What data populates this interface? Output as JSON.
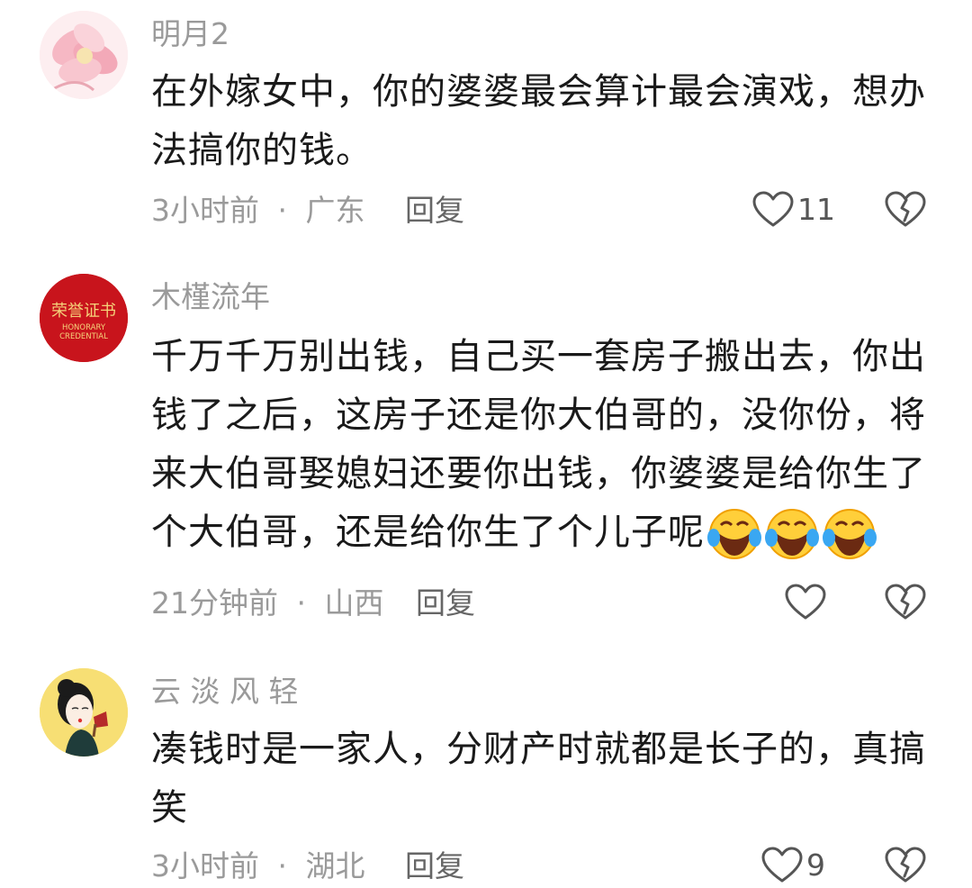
{
  "comments": [
    {
      "username": "明月2",
      "avatar": "pink-flower-avatar",
      "text": "在外嫁女中，你的婆婆最会算计最会演戏，想办法搞你的钱。",
      "time": "3小时前",
      "separator": "·",
      "location": "广东",
      "reply_label": "回复",
      "like_count": "11"
    },
    {
      "username": "木槿流年",
      "avatar": "honorary-credential-avatar",
      "avatar_text_cn": "荣誉证书",
      "avatar_text_en1": "HONORARY",
      "avatar_text_en2": "CREDENTIAL",
      "text": "千万千万别出钱，自己买一套房子搬出去，你出钱了之后，这房子还是你大伯哥的，没你份，将来大伯哥娶媳妇还要你出钱，你婆婆是给你生了个大伯哥，还是给你生了个儿子呢",
      "emojis": [
        "laugh-cry-emoji",
        "laugh-cry-emoji",
        "laugh-cry-emoji"
      ],
      "time": "21分钟前",
      "separator": "·",
      "location": "山西",
      "reply_label": "回复",
      "like_count": ""
    },
    {
      "username": "云 淡 风 轻",
      "avatar": "illustrated-woman-avatar",
      "text": "凑钱时是一家人，分财产时就都是长子的，真搞笑",
      "time": "3小时前",
      "separator": "·",
      "location": "湖北",
      "reply_label": "回复",
      "like_count": "9"
    }
  ],
  "colors": {
    "text": "#1a1a1a",
    "secondary": "#9a9a9a",
    "credential_red": "#c8141c",
    "credential_gold": "#f5d27a"
  }
}
